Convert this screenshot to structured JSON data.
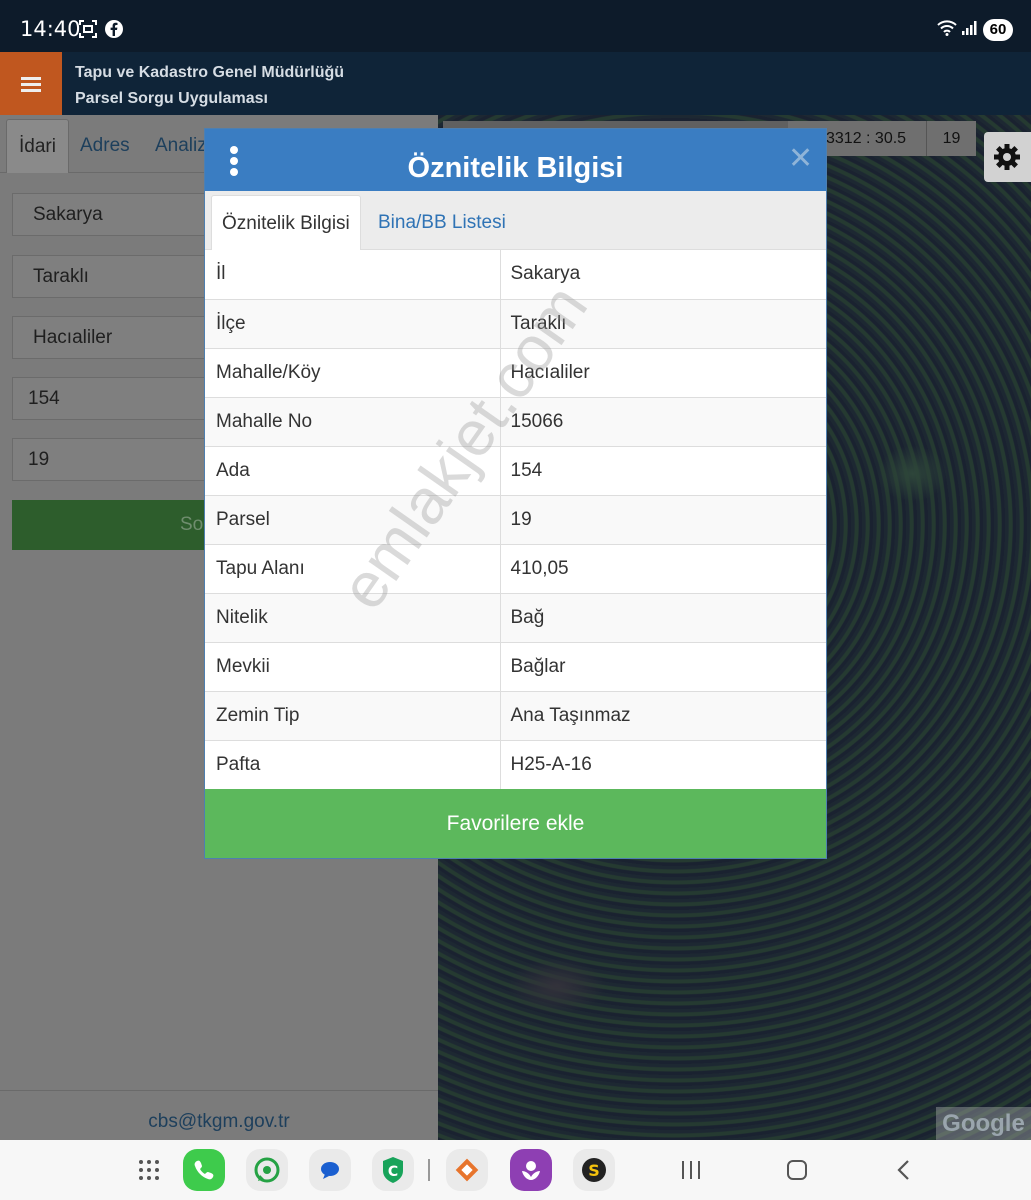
{
  "status_bar": {
    "time": "14:40",
    "battery": "60"
  },
  "app": {
    "title_line1": "Tapu ve Kadastro Genel Müdürlüğü",
    "title_line2": "Parsel Sorgu Uygulaması"
  },
  "left_panel": {
    "tabs": [
      {
        "label": "İdari"
      },
      {
        "label": "Adres"
      },
      {
        "label": "Analiz"
      }
    ],
    "fields": [
      "Sakarya",
      "Taraklı",
      "Hacıaliler",
      "154",
      "19"
    ],
    "search_label": "So",
    "email": "cbs@tkgm.gov.tr"
  },
  "map": {
    "scale": "3312 : 30.5",
    "zoom": "19",
    "attribution": "Google"
  },
  "modal": {
    "title": "Öznitelik Bilgisi",
    "tabs": {
      "active": "Öznitelik Bilgisi",
      "other": "Bina/BB Listesi"
    },
    "rows": [
      {
        "label": "İl",
        "value": "Sakarya"
      },
      {
        "label": "İlçe",
        "value": "Taraklı"
      },
      {
        "label": "Mahalle/Köy",
        "value": "Hacıaliler"
      },
      {
        "label": "Mahalle No",
        "value": "15066"
      },
      {
        "label": "Ada",
        "value": "154"
      },
      {
        "label": "Parsel",
        "value": "19"
      },
      {
        "label": "Tapu Alanı",
        "value": "410,05"
      },
      {
        "label": "Nitelik",
        "value": "Bağ"
      },
      {
        "label": "Mevkii",
        "value": "Bağlar"
      },
      {
        "label": "Zemin Tip",
        "value": "Ana Taşınmaz"
      },
      {
        "label": "Pafta",
        "value": "H25-A-16"
      }
    ],
    "favorite_button": "Favorilere ekle"
  },
  "watermark": "emlakjet.com",
  "colors": {
    "header": "#0f2438",
    "modal_header": "#3a7dc2",
    "favorite": "#5cb85c",
    "menu": "#c0571f"
  }
}
